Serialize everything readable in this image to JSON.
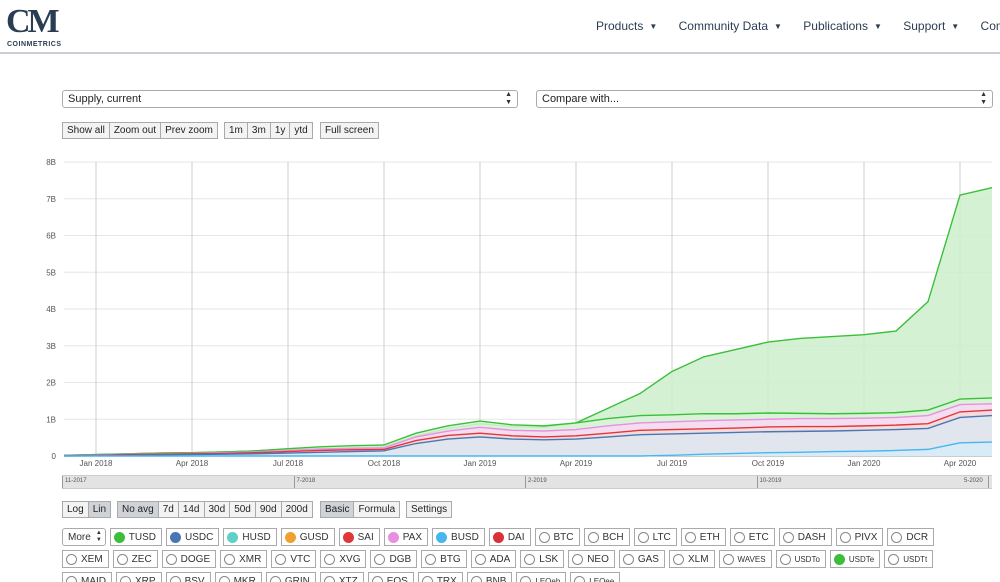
{
  "brand": {
    "mark": "CM",
    "name": "COINMETRICS"
  },
  "nav": [
    {
      "label": "Products"
    },
    {
      "label": "Community Data"
    },
    {
      "label": "Publications"
    },
    {
      "label": "Support"
    },
    {
      "label": "Company"
    }
  ],
  "metric_select": {
    "value": "Supply, current"
  },
  "compare_select": {
    "value": "Compare with..."
  },
  "zoom_buttons": [
    "Show all",
    "Zoom out",
    "Prev zoom"
  ],
  "range_buttons": [
    "1m",
    "3m",
    "1y",
    "ytd"
  ],
  "fullscreen_label": "Full screen",
  "scale_buttons": [
    {
      "label": "Log",
      "active": false
    },
    {
      "label": "Lin",
      "active": true
    }
  ],
  "avg_buttons": [
    {
      "label": "No avg",
      "active": true
    },
    {
      "label": "7d",
      "active": false
    },
    {
      "label": "14d",
      "active": false
    },
    {
      "label": "30d",
      "active": false
    },
    {
      "label": "50d",
      "active": false
    },
    {
      "label": "90d",
      "active": false
    },
    {
      "label": "200d",
      "active": false
    }
  ],
  "mode_buttons": [
    {
      "label": "Basic",
      "active": true
    },
    {
      "label": "Formula",
      "active": false
    }
  ],
  "settings_label": "Settings",
  "more_label": "More",
  "asset_rows": [
    [
      {
        "label": "TUSD",
        "color": "#3bbf3b"
      },
      {
        "label": "USDC",
        "color": "#4a77b4"
      },
      {
        "label": "HUSD",
        "color": "#5fd0c8"
      },
      {
        "label": "GUSD",
        "color": "#f0a030"
      },
      {
        "label": "SAI",
        "color": "#e0383a"
      },
      {
        "label": "PAX",
        "color": "#e98fe0"
      },
      {
        "label": "BUSD",
        "color": "#49b6ee"
      },
      {
        "label": "DAI",
        "color": "#d9303a"
      },
      {
        "label": "BTC",
        "color": null
      },
      {
        "label": "BCH",
        "color": null
      },
      {
        "label": "LTC",
        "color": null
      },
      {
        "label": "ETH",
        "color": null
      },
      {
        "label": "ETC",
        "color": null
      },
      {
        "label": "DASH",
        "color": null
      },
      {
        "label": "PIVX",
        "color": null
      },
      {
        "label": "DCR",
        "color": null
      }
    ],
    [
      {
        "label": "XEM",
        "color": null
      },
      {
        "label": "ZEC",
        "color": null
      },
      {
        "label": "DOGE",
        "color": null
      },
      {
        "label": "XMR",
        "color": null
      },
      {
        "label": "VTC",
        "color": null
      },
      {
        "label": "XVG",
        "color": null
      },
      {
        "label": "DGB",
        "color": null
      },
      {
        "label": "BTG",
        "color": null
      },
      {
        "label": "ADA",
        "color": null
      },
      {
        "label": "LSK",
        "color": null
      },
      {
        "label": "NEO",
        "color": null
      },
      {
        "label": "GAS",
        "color": null
      },
      {
        "label": "XLM",
        "color": null
      },
      {
        "label": "WAVES",
        "color": null,
        "small": true
      },
      {
        "label": "USDTo",
        "color": null,
        "small": true
      },
      {
        "label": "USDTe",
        "color": "#3bbf3b",
        "small": true
      },
      {
        "label": "USDTt",
        "color": null,
        "small": true
      }
    ],
    [
      {
        "label": "MAID",
        "color": null
      },
      {
        "label": "XRP",
        "color": null
      },
      {
        "label": "BSV",
        "color": null
      },
      {
        "label": "MKR",
        "color": null
      },
      {
        "label": "GRIN",
        "color": null
      },
      {
        "label": "XTZ",
        "color": null
      },
      {
        "label": "EOS",
        "color": null
      },
      {
        "label": "TRX",
        "color": null
      },
      {
        "label": "BNB",
        "color": null
      },
      {
        "label": "LEOeb",
        "color": null,
        "small": true
      },
      {
        "label": "LEOee",
        "color": null,
        "small": true
      }
    ]
  ],
  "navigator_labels": [
    "11-2017",
    "7-2018",
    "2-2019",
    "10-2019",
    "5-2020"
  ],
  "chart_data": {
    "type": "area",
    "title": "",
    "xlabel": "",
    "ylabel": "",
    "y_ticks": [
      "0",
      "1B",
      "2B",
      "3B",
      "4B",
      "5B",
      "6B",
      "7B",
      "8B"
    ],
    "ylim": [
      0,
      8
    ],
    "y_unit": "B",
    "x_ticks": [
      "Jan 2018",
      "Apr 2018",
      "Jul 2018",
      "Oct 2018",
      "Jan 2019",
      "Apr 2019",
      "Jul 2019",
      "Oct 2019",
      "Jan 2020",
      "Apr 2020"
    ],
    "x_tick_index": [
      0,
      3,
      6,
      9,
      12,
      15,
      18,
      21,
      24,
      27
    ],
    "grid": true,
    "legend": "none",
    "months": [
      "Dec 2017",
      "Jan 2018",
      "Feb 2018",
      "Mar 2018",
      "Apr 2018",
      "May 2018",
      "Jun 2018",
      "Jul 2018",
      "Aug 2018",
      "Sep 2018",
      "Oct 2018",
      "Nov 2018",
      "Dec 2018",
      "Jan 2019",
      "Feb 2019",
      "Mar 2019",
      "Apr 2019",
      "May 2019",
      "Jun 2019",
      "Jul 2019",
      "Aug 2019",
      "Sep 2019",
      "Oct 2019",
      "Nov 2019",
      "Dec 2019",
      "Jan 2020",
      "Feb 2020",
      "Mar 2020",
      "Apr 2020",
      "May 2020"
    ],
    "x": [
      -1,
      0,
      1,
      2,
      3,
      4,
      5,
      6,
      7,
      8,
      9,
      10,
      11,
      12,
      13,
      14,
      15,
      16,
      17,
      18,
      19,
      20,
      21,
      22,
      23,
      24,
      25,
      26,
      27,
      28
    ],
    "series": [
      {
        "name": "USDTe",
        "color": "#3bbf3b",
        "fill": "#ccefcc",
        "values": [
          0.02,
          0.04,
          0.06,
          0.08,
          0.09,
          0.11,
          0.14,
          0.18,
          0.2,
          0.22,
          0.25,
          0.55,
          0.75,
          0.88,
          0.8,
          0.78,
          0.9,
          1.3,
          1.7,
          2.3,
          2.7,
          2.9,
          3.1,
          3.2,
          3.25,
          3.3,
          3.4,
          4.2,
          7.1,
          7.3
        ]
      },
      {
        "name": "TUSD",
        "color": "#3bbf3b",
        "fill": "#d9f3d9",
        "values": [
          0.02,
          0.04,
          0.06,
          0.08,
          0.09,
          0.11,
          0.14,
          0.2,
          0.25,
          0.28,
          0.3,
          0.62,
          0.82,
          0.95,
          0.85,
          0.82,
          0.9,
          1.02,
          1.1,
          1.12,
          1.15,
          1.15,
          1.17,
          1.16,
          1.15,
          1.16,
          1.18,
          1.25,
          1.55,
          1.58
        ]
      },
      {
        "name": "PAX",
        "color": "#e98fe0",
        "fill": "#f8d8f4",
        "values": [
          0.01,
          0.03,
          0.05,
          0.06,
          0.07,
          0.09,
          0.11,
          0.15,
          0.19,
          0.21,
          0.22,
          0.52,
          0.68,
          0.78,
          0.7,
          0.68,
          0.72,
          0.82,
          0.9,
          0.93,
          0.96,
          0.98,
          1.0,
          1.02,
          1.02,
          1.03,
          1.05,
          1.1,
          1.4,
          1.42
        ]
      },
      {
        "name": "SAI",
        "color": "#e0383a",
        "fill": "#f5dada",
        "values": [
          0.01,
          0.02,
          0.04,
          0.05,
          0.06,
          0.07,
          0.09,
          0.12,
          0.15,
          0.17,
          0.18,
          0.42,
          0.56,
          0.62,
          0.55,
          0.52,
          0.55,
          0.62,
          0.7,
          0.72,
          0.74,
          0.76,
          0.79,
          0.8,
          0.8,
          0.82,
          0.84,
          0.88,
          1.2,
          1.25
        ]
      },
      {
        "name": "USDC",
        "color": "#4a77b4",
        "fill": "#dde6f0",
        "values": [
          0.0,
          0.01,
          0.02,
          0.03,
          0.04,
          0.05,
          0.06,
          0.08,
          0.1,
          0.12,
          0.14,
          0.34,
          0.46,
          0.52,
          0.46,
          0.44,
          0.46,
          0.52,
          0.58,
          0.6,
          0.62,
          0.64,
          0.66,
          0.67,
          0.68,
          0.7,
          0.72,
          0.75,
          1.05,
          1.1
        ]
      },
      {
        "name": "BUSD",
        "color": "#49b6ee",
        "fill": "#d6ecf8",
        "values": [
          0,
          0,
          0,
          0,
          0,
          0,
          0,
          0,
          0,
          0,
          0,
          0,
          0,
          0,
          0,
          0,
          0,
          0,
          0,
          0.02,
          0.05,
          0.07,
          0.09,
          0.1,
          0.12,
          0.13,
          0.15,
          0.18,
          0.36,
          0.38
        ]
      }
    ]
  }
}
